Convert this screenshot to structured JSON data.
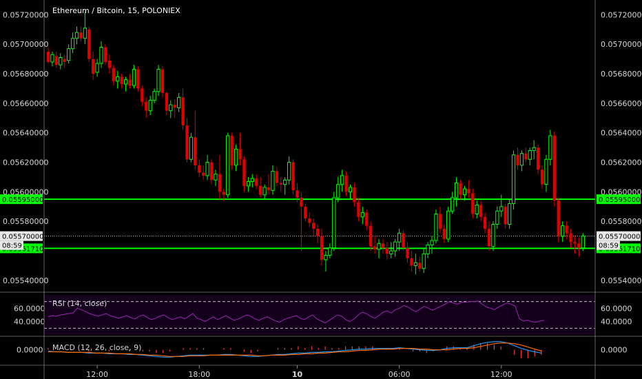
{
  "chart_data": {
    "type": "candlestick",
    "title": "Ethereum / Bitcoin, 15, POLONIEX",
    "y_ticks": [
      "0.05720000",
      "0.05700000",
      "0.05680000",
      "0.05660000",
      "0.05640000",
      "0.05620000",
      "0.05600000",
      "0.05580000",
      "0.05540000"
    ],
    "ylim": [
      0.05532,
      0.0573
    ],
    "x_ticks": [
      "12:00",
      "18:00",
      "10",
      "06:00",
      "12:00"
    ],
    "levels": [
      {
        "label": "0.05595000",
        "value": 0.05595,
        "color": "#00ff00",
        "style": "solid"
      },
      {
        "label": "0.05561710",
        "value": 0.0556171,
        "color": "#00ff00",
        "style": "solid"
      },
      {
        "label": "0.05570000",
        "value": 0.0557,
        "color": "#cccccc",
        "style": "dotted"
      }
    ],
    "countdown": "08:59",
    "colors": {
      "up": "#00ff00",
      "down": "#e00000",
      "bg": "#000000",
      "rsi": "#9c27b0",
      "macd": "#2196f3",
      "signal": "#ff6d00"
    },
    "candles": [
      [
        0.05695,
        0.05698,
        0.05687,
        0.05688
      ],
      [
        0.05688,
        0.05695,
        0.05685,
        0.05693
      ],
      [
        0.05692,
        0.05695,
        0.05684,
        0.05686
      ],
      [
        0.05686,
        0.05694,
        0.05683,
        0.05691
      ],
      [
        0.0569,
        0.05693,
        0.05684,
        0.05688
      ],
      [
        0.05689,
        0.057,
        0.05687,
        0.05697
      ],
      [
        0.05697,
        0.05708,
        0.05694,
        0.05704
      ],
      [
        0.05704,
        0.05712,
        0.057,
        0.05708
      ],
      [
        0.05708,
        0.05712,
        0.05702,
        0.05704
      ],
      [
        0.05704,
        0.05722,
        0.057,
        0.05711
      ],
      [
        0.0571,
        0.05712,
        0.05688,
        0.0569
      ],
      [
        0.0569,
        0.05695,
        0.05676,
        0.0568
      ],
      [
        0.05681,
        0.0569,
        0.05678,
        0.05687
      ],
      [
        0.05687,
        0.05702,
        0.05684,
        0.05698
      ],
      [
        0.05698,
        0.057,
        0.05686,
        0.05688
      ],
      [
        0.05689,
        0.05693,
        0.0568,
        0.05684
      ],
      [
        0.05684,
        0.05686,
        0.05672,
        0.05675
      ],
      [
        0.05675,
        0.05682,
        0.0567,
        0.05678
      ],
      [
        0.05678,
        0.0568,
        0.0567,
        0.05673
      ],
      [
        0.05673,
        0.05678,
        0.05668,
        0.05676
      ],
      [
        0.05676,
        0.0568,
        0.0567,
        0.05672
      ],
      [
        0.05672,
        0.05686,
        0.0567,
        0.05683
      ],
      [
        0.05683,
        0.05685,
        0.05668,
        0.0567
      ],
      [
        0.0567,
        0.05672,
        0.05658,
        0.05661
      ],
      [
        0.05661,
        0.05664,
        0.0565,
        0.05655
      ],
      [
        0.05655,
        0.05665,
        0.05652,
        0.05662
      ],
      [
        0.05662,
        0.0567,
        0.0566,
        0.05668
      ],
      [
        0.05668,
        0.05686,
        0.05665,
        0.05683
      ],
      [
        0.05683,
        0.05685,
        0.05664,
        0.05667
      ],
      [
        0.05667,
        0.05668,
        0.05652,
        0.05655
      ],
      [
        0.05655,
        0.05662,
        0.0565,
        0.05659
      ],
      [
        0.05659,
        0.05663,
        0.0565,
        0.05657
      ],
      [
        0.05657,
        0.05667,
        0.05654,
        0.05664
      ],
      [
        0.05664,
        0.0567,
        0.05642,
        0.05645
      ],
      [
        0.05645,
        0.0565,
        0.0562,
        0.05622
      ],
      [
        0.05622,
        0.0564,
        0.0562,
        0.05637
      ],
      [
        0.05637,
        0.05655,
        0.05615,
        0.05618
      ],
      [
        0.05618,
        0.05622,
        0.0561,
        0.05613
      ],
      [
        0.05613,
        0.05618,
        0.05608,
        0.05611
      ],
      [
        0.05611,
        0.05625,
        0.05608,
        0.0562
      ],
      [
        0.0562,
        0.05622,
        0.05605,
        0.05608
      ],
      [
        0.05608,
        0.05615,
        0.05604,
        0.05612
      ],
      [
        0.05612,
        0.05625,
        0.05595,
        0.056
      ],
      [
        0.056,
        0.05602,
        0.05594,
        0.05598
      ],
      [
        0.05598,
        0.0564,
        0.05596,
        0.05638
      ],
      [
        0.05638,
        0.0564,
        0.05615,
        0.05618
      ],
      [
        0.05618,
        0.05632,
        0.05614,
        0.05629
      ],
      [
        0.05629,
        0.0564,
        0.05618,
        0.05622
      ],
      [
        0.05622,
        0.05624,
        0.056,
        0.05604
      ],
      [
        0.05604,
        0.0561,
        0.056,
        0.05607
      ],
      [
        0.05607,
        0.05612,
        0.05603,
        0.05609
      ],
      [
        0.05609,
        0.05612,
        0.05602,
        0.05604
      ],
      [
        0.05604,
        0.0561,
        0.05596,
        0.05598
      ],
      [
        0.05598,
        0.05605,
        0.05595,
        0.05603
      ],
      [
        0.05603,
        0.05612,
        0.05598,
        0.05601
      ],
      [
        0.05601,
        0.05618,
        0.05598,
        0.05614
      ],
      [
        0.05614,
        0.05617,
        0.05604,
        0.05606
      ],
      [
        0.05606,
        0.0561,
        0.056,
        0.05605
      ],
      [
        0.05605,
        0.0561,
        0.05598,
        0.05608
      ],
      [
        0.05608,
        0.05624,
        0.05605,
        0.0562
      ],
      [
        0.0562,
        0.05622,
        0.05598,
        0.05601
      ],
      [
        0.05601,
        0.05606,
        0.05593,
        0.05596
      ],
      [
        0.05596,
        0.056,
        0.0556,
        0.0559
      ],
      [
        0.0559,
        0.05592,
        0.0558,
        0.05582
      ],
      [
        0.05582,
        0.05586,
        0.05576,
        0.05579
      ],
      [
        0.05579,
        0.05582,
        0.0557,
        0.05575
      ],
      [
        0.05575,
        0.05578,
        0.05565,
        0.0557
      ],
      [
        0.0557,
        0.05575,
        0.0555,
        0.05554
      ],
      [
        0.05554,
        0.0556,
        0.05546,
        0.05557
      ],
      [
        0.05557,
        0.05565,
        0.05555,
        0.05562
      ],
      [
        0.05562,
        0.056,
        0.0556,
        0.05596
      ],
      [
        0.05596,
        0.0561,
        0.05593,
        0.05605
      ],
      [
        0.05605,
        0.05615,
        0.056,
        0.05611
      ],
      [
        0.05611,
        0.05614,
        0.05597,
        0.056
      ],
      [
        0.056,
        0.05605,
        0.05595,
        0.05603
      ],
      [
        0.05603,
        0.05606,
        0.0559,
        0.05593
      ],
      [
        0.05593,
        0.05596,
        0.0558,
        0.05583
      ],
      [
        0.05583,
        0.0559,
        0.05578,
        0.05586
      ],
      [
        0.05586,
        0.05588,
        0.05574,
        0.05577
      ],
      [
        0.05577,
        0.0558,
        0.0556,
        0.05563
      ],
      [
        0.05563,
        0.0557,
        0.05558,
        0.05561
      ],
      [
        0.05561,
        0.05568,
        0.05555,
        0.05565
      ],
      [
        0.05565,
        0.05568,
        0.05558,
        0.05562
      ],
      [
        0.05562,
        0.05566,
        0.05554,
        0.05558
      ],
      [
        0.05558,
        0.05566,
        0.05555,
        0.0556
      ],
      [
        0.0556,
        0.05568,
        0.05556,
        0.05566
      ],
      [
        0.05566,
        0.05575,
        0.0556,
        0.05572
      ],
      [
        0.05572,
        0.05574,
        0.0556,
        0.05562
      ],
      [
        0.05562,
        0.05566,
        0.05552,
        0.05555
      ],
      [
        0.05555,
        0.0556,
        0.05546,
        0.0555
      ],
      [
        0.0555,
        0.05558,
        0.05544,
        0.05552
      ],
      [
        0.05552,
        0.05556,
        0.05546,
        0.05548
      ],
      [
        0.05548,
        0.05562,
        0.05545,
        0.05558
      ],
      [
        0.05558,
        0.05566,
        0.05555,
        0.05564
      ],
      [
        0.05564,
        0.0557,
        0.05558,
        0.05567
      ],
      [
        0.05567,
        0.05588,
        0.05565,
        0.05585
      ],
      [
        0.05585,
        0.0559,
        0.05572,
        0.05575
      ],
      [
        0.05575,
        0.05578,
        0.05565,
        0.05568
      ],
      [
        0.05568,
        0.0559,
        0.05566,
        0.05587
      ],
      [
        0.05587,
        0.056,
        0.05585,
        0.05596
      ],
      [
        0.05596,
        0.0561,
        0.0559,
        0.05606
      ],
      [
        0.05606,
        0.05608,
        0.05595,
        0.05598
      ],
      [
        0.05598,
        0.05604,
        0.05594,
        0.05602
      ],
      [
        0.05602,
        0.05608,
        0.05596,
        0.05599
      ],
      [
        0.05599,
        0.05602,
        0.05582,
        0.05585
      ],
      [
        0.05585,
        0.05594,
        0.05582,
        0.05591
      ],
      [
        0.05591,
        0.05594,
        0.0558,
        0.05583
      ],
      [
        0.05583,
        0.05586,
        0.05572,
        0.05575
      ],
      [
        0.05575,
        0.0558,
        0.0556,
        0.05563
      ],
      [
        0.05563,
        0.0558,
        0.0556,
        0.05578
      ],
      [
        0.05578,
        0.0559,
        0.05575,
        0.05587
      ],
      [
        0.05587,
        0.05598,
        0.05583,
        0.0559
      ],
      [
        0.0559,
        0.05592,
        0.05575,
        0.05578
      ],
      [
        0.05578,
        0.05595,
        0.05575,
        0.05592
      ],
      [
        0.05592,
        0.05628,
        0.05588,
        0.05625
      ],
      [
        0.05625,
        0.0563,
        0.05615,
        0.05618
      ],
      [
        0.05618,
        0.05628,
        0.05614,
        0.05626
      ],
      [
        0.05626,
        0.0563,
        0.0562,
        0.05622
      ],
      [
        0.05622,
        0.0563,
        0.05618,
        0.05628
      ],
      [
        0.05628,
        0.05635,
        0.05622,
        0.0563
      ],
      [
        0.0563,
        0.05632,
        0.05612,
        0.05615
      ],
      [
        0.05615,
        0.05618,
        0.05602,
        0.05605
      ],
      [
        0.05605,
        0.05625,
        0.056,
        0.05622
      ],
      [
        0.05622,
        0.05642,
        0.05618,
        0.05638
      ],
      [
        0.05638,
        0.05641,
        0.0559,
        0.05594
      ],
      [
        0.05594,
        0.05596,
        0.05566,
        0.0557
      ],
      [
        0.0557,
        0.0558,
        0.05566,
        0.05577
      ],
      [
        0.05577,
        0.0558,
        0.05568,
        0.05572
      ],
      [
        0.05572,
        0.05575,
        0.05562,
        0.05566
      ],
      [
        0.05566,
        0.0557,
        0.05558,
        0.05565
      ],
      [
        0.05565,
        0.05569,
        0.05556,
        0.05562
      ],
      [
        0.05562,
        0.05572,
        0.0556,
        0.0557
      ]
    ],
    "rsi": {
      "label": "RSI (14, close)",
      "ylim": [
        20,
        80
      ],
      "ticks": [
        "60.0000",
        "40.0000"
      ],
      "upper": 70,
      "lower": 30,
      "values": [
        47,
        49,
        48,
        50,
        51,
        52,
        53,
        60,
        58,
        55,
        52,
        50,
        48,
        50,
        52,
        49,
        47,
        45,
        47,
        49,
        46,
        44,
        48,
        50,
        46,
        43,
        45,
        48,
        50,
        46,
        43,
        45,
        47,
        44,
        48,
        52,
        45,
        43,
        40,
        44,
        47,
        43,
        46,
        49,
        45,
        42,
        44,
        47,
        50,
        48,
        44,
        42,
        45,
        47,
        44,
        41,
        39,
        43,
        45,
        47,
        49,
        45,
        43,
        47,
        50,
        44,
        41,
        38,
        42,
        46,
        50,
        48,
        43,
        40,
        44,
        50,
        54,
        52,
        48,
        45,
        49,
        54,
        56,
        53,
        58,
        60,
        64,
        62,
        58,
        55,
        59,
        63,
        60,
        57,
        60,
        63,
        66,
        70,
        68,
        66,
        69,
        69,
        70,
        70,
        71,
        66,
        62,
        60,
        58,
        62,
        65,
        68,
        66,
        63,
        44,
        41,
        42,
        40,
        39,
        41,
        42
      ]
    },
    "macd": {
      "label": "MACD (12, 26, close, 9)",
      "ylim": [
        -0.00022,
        0.00018
      ],
      "ticks": [
        "0.0000"
      ],
      "macd": [
        -2e-05,
        -3e-05,
        -3e-05,
        -4e-05,
        -4e-05,
        -4e-05,
        -5e-05,
        -5e-05,
        -5e-05,
        -6e-05,
        -6e-05,
        -6e-05,
        -7e-05,
        -7e-05,
        -8e-05,
        -9e-05,
        -0.0001,
        -0.00011,
        -0.00011,
        -0.0001,
        -9e-05,
        -8e-05,
        -8e-05,
        -8e-05,
        -8e-05,
        -8e-05,
        -7e-05,
        -7e-05,
        -8e-05,
        -9e-05,
        -0.0001,
        -0.0001,
        -9e-05,
        -8e-05,
        -7e-05,
        -7e-05,
        -6e-05,
        -5e-05,
        -5e-05,
        -4e-05,
        -4e-05,
        -3e-05,
        -3e-05,
        -2e-05,
        -1e-05,
        0.0,
        1e-05,
        1e-05,
        2e-05,
        2e-05,
        2e-05,
        2e-05,
        3e-05,
        2e-05,
        1e-05,
        0.0,
        -1e-05,
        -1e-05,
        0.0,
        2e-05,
        3e-05,
        3e-05,
        3e-05,
        6e-05,
        9e-05,
        0.00011,
        0.00012,
        0.00012,
        0.0001,
        6e-05,
        2e-05,
        -1e-05,
        -3e-05,
        -5e-05
      ],
      "signal": [
        -3e-05,
        -3e-05,
        -3e-05,
        -4e-05,
        -4e-05,
        -4e-05,
        -4e-05,
        -5e-05,
        -5e-05,
        -5e-05,
        -6e-05,
        -6e-05,
        -6e-05,
        -7e-05,
        -7e-05,
        -8e-05,
        -8e-05,
        -9e-05,
        -0.0001,
        -0.0001,
        -0.0001,
        -9e-05,
        -9e-05,
        -9e-05,
        -8e-05,
        -8e-05,
        -8e-05,
        -8e-05,
        -8e-05,
        -8e-05,
        -8e-05,
        -9e-05,
        -9e-05,
        -8e-05,
        -8e-05,
        -8e-05,
        -7e-05,
        -7e-05,
        -6e-05,
        -6e-05,
        -5e-05,
        -5e-05,
        -4e-05,
        -3e-05,
        -3e-05,
        -2e-05,
        -1e-05,
        -1e-05,
        0.0,
        1e-05,
        1e-05,
        1e-05,
        2e-05,
        2e-05,
        2e-05,
        1e-05,
        1e-05,
        0.0,
        0.0,
        0.0,
        1e-05,
        2e-05,
        2e-05,
        3e-05,
        5e-05,
        7e-05,
        9e-05,
        0.0001,
        0.0001,
        9e-05,
        7e-05,
        4e-05,
        1e-05,
        -2e-05
      ]
    }
  }
}
